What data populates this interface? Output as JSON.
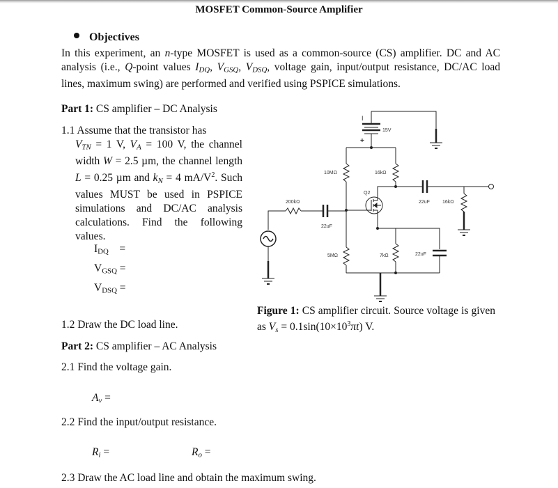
{
  "document": {
    "title": "MOSFET Common-Source Amplifier",
    "objectives": {
      "heading": "Objectives",
      "text_parts": {
        "p1": "In this experiment, an ",
        "n": "n",
        "p2": "-type MOSFET is used as a common-source (CS) amplifier. DC and AC analysis (i.e., ",
        "q": "Q",
        "p3": "-point values ",
        "idq_main": "I",
        "idq_sub": "DQ",
        "vgsq_main": "V",
        "vgsq_sub": "GSQ",
        "vdsq_main": "V",
        "vdsq_sub": "DSQ",
        "p4": ", voltage gain, input/output resistance, DC/AC load lines, maximum swing) are performed and verified using PSPICE simulations."
      }
    },
    "part1": {
      "label": "Part 1:",
      "title": " CS amplifier – DC Analysis",
      "q11": {
        "lead": "1.1 Assume that the transistor has",
        "vtn": "V",
        "vtn_sub": "TN",
        "vtn_val": " = 1 V, ",
        "va": "V",
        "va_sub": "A",
        "va_val": " = 100 V, the channel width ",
        "w": "W",
        "w_val": " = 2.5 µm, the channel length ",
        "l": "L",
        "l_val": " = 0.25 µm and ",
        "kn": "k",
        "kn_sub": "N",
        "kn_val": " = 4 mA/V",
        "kn_sup": "2",
        "tail": ". Such values MUST be used in PSPICE simulations and DC/AC analysis calculations. Find the following values."
      },
      "answers": [
        {
          "main": "I",
          "sub": "DQ",
          "eq": "    ="
        },
        {
          "main": "V",
          "sub": "GSQ",
          "eq": " ="
        },
        {
          "main": "V",
          "sub": "DSQ",
          "eq": " ="
        }
      ],
      "q12": "1.2 Draw the DC load line."
    },
    "part2": {
      "label": "Part 2:",
      "title": " CS amplifier – AC Analysis",
      "q21": "2.1 Find the voltage gain.",
      "av": {
        "main": "A",
        "sub": "v",
        "eq": " ="
      },
      "q22": "2.2 Find the input/output resistance.",
      "ri": {
        "main": "R",
        "sub": "i",
        "eq": " ="
      },
      "ro": {
        "main": "R",
        "sub": "o",
        "eq": " ="
      },
      "q23": "2.3 Draw the AC load line and obtain the maximum swing."
    },
    "figure": {
      "label": "Figure 1:",
      "caption_a": " CS amplifier circuit. Source voltage is given as ",
      "vs": "V",
      "vs_sub": "s",
      "caption_b": " = 0.1sin(10×10",
      "caption_sup": "3",
      "caption_c": "πt",
      "caption_d": ") V."
    },
    "circuit": {
      "supply": "15V",
      "battery_minus": "I",
      "battery_plus": "+",
      "r_gate_top": "10MΩ",
      "r_gate_bottom": "5MΩ",
      "r_drain": "16kΩ",
      "r_source": "7kΩ",
      "r_series": "200kΩ",
      "r_load": "16kΩ",
      "c_in": "22uF",
      "c_out": "22uF",
      "c_bypass": "22uF",
      "transistor": "Q2"
    }
  }
}
